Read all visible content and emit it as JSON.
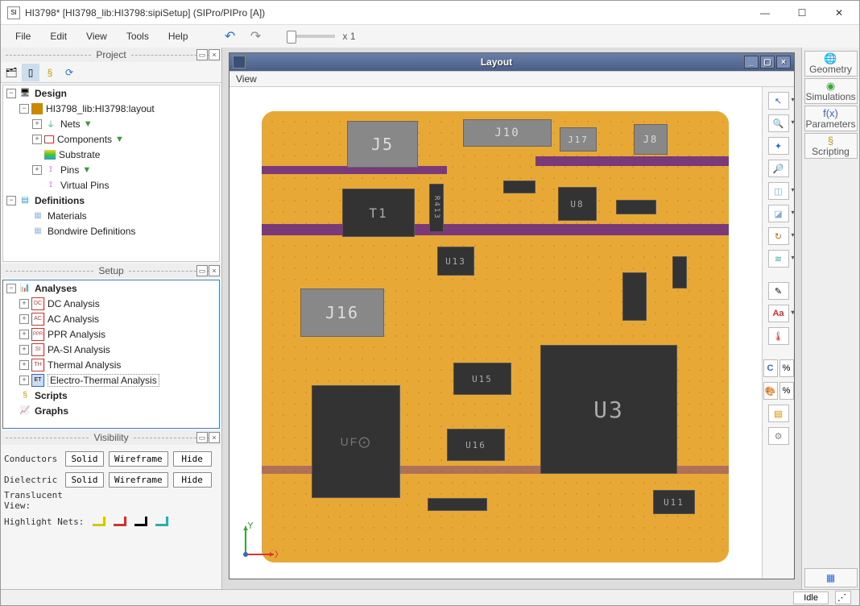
{
  "window": {
    "title": "HI3798* [HI3798_lib:HI3798:sipiSetup] (SIPro/PIPro [A])"
  },
  "menu": {
    "file": "File",
    "edit": "Edit",
    "view": "View",
    "tools": "Tools",
    "help": "Help",
    "zoom": "x 1"
  },
  "panels": {
    "project": "Project",
    "setup": "Setup",
    "visibility": "Visibility"
  },
  "proj": {
    "design": "Design",
    "layout": "HI3798_lib:HI3798:layout",
    "nets": "Nets",
    "components": "Components",
    "substrate": "Substrate",
    "pins": "Pins",
    "vpins": "Virtual Pins",
    "defs": "Definitions",
    "materials": "Materials",
    "bondwire": "Bondwire Definitions"
  },
  "setup": {
    "analyses": "Analyses",
    "dc": "DC Analysis",
    "ac": "AC Analysis",
    "ppr": "PPR Analysis",
    "pasi": "PA-SI Analysis",
    "thermal": "Thermal Analysis",
    "ethermal": "Electro-Thermal Analysis",
    "scripts": "Scripts",
    "graphs": "Graphs"
  },
  "vis": {
    "conductors": "Conductors",
    "dielectric": "Dielectric",
    "translucent": "Translucent View:",
    "highlight": "Highlight Nets:",
    "solid": "Solid",
    "wireframe": "Wireframe",
    "hide": "Hide"
  },
  "layout": {
    "title": "Layout",
    "view": "View"
  },
  "pcb": {
    "J5": "J5",
    "J10": "J10",
    "J17": "J17",
    "J8": "J8",
    "T1": "T1",
    "U8": "U8",
    "U13": "U13",
    "J16": "J16",
    "U15": "U15",
    "U3": "U3",
    "U16": "U16",
    "U11": "U11",
    "R413": "R413"
  },
  "rtabs": {
    "geometry": "Geometry",
    "simulations": "Simulations",
    "parameters": "Parameters",
    "scripting": "Scripting"
  },
  "status": {
    "idle": "Idle"
  }
}
